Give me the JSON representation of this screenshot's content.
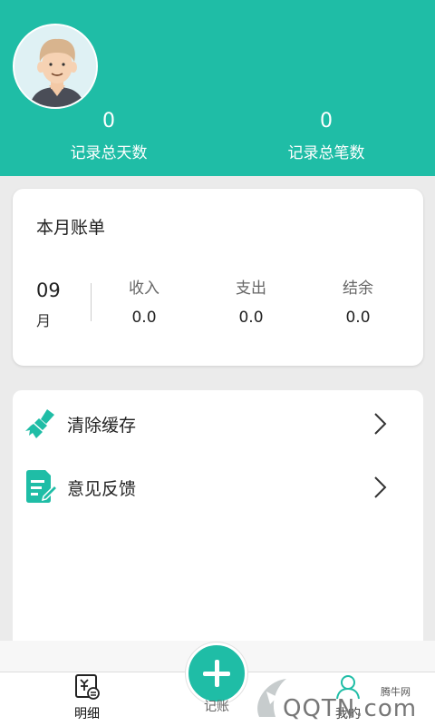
{
  "header": {
    "total_days_value": "0",
    "total_days_label": "记录总天数",
    "total_entries_value": "0",
    "total_entries_label": "记录总笔数",
    "bg_color": "#1fbda6"
  },
  "bill": {
    "title": "本月账单",
    "month": "09",
    "month_unit": "月",
    "income_label": "收入",
    "income_value": "0.0",
    "expense_label": "支出",
    "expense_value": "0.0",
    "balance_label": "结余",
    "balance_value": "0.0"
  },
  "menu": {
    "items": [
      {
        "label": "清除缓存",
        "icon": "broom-icon"
      },
      {
        "label": "意见反馈",
        "icon": "feedback-icon"
      }
    ]
  },
  "tabbar": {
    "detail_label": "明细",
    "record_label": "记账",
    "mine_label": "我的"
  },
  "watermark": {
    "site_name": "腾牛网",
    "logo_text": "QQTN.com"
  },
  "colors": {
    "accent": "#1fbda6"
  }
}
